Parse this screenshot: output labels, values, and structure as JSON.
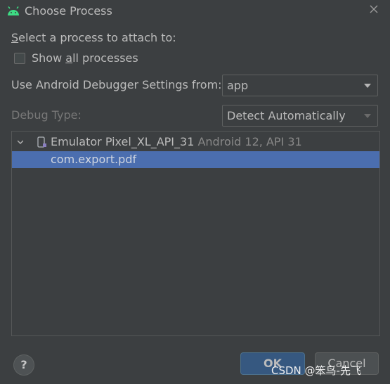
{
  "window": {
    "title": "Choose Process",
    "close_icon": "close-icon"
  },
  "prompt": {
    "label_first_letter": "S",
    "label_rest": "elect a process to attach to:"
  },
  "show_all": {
    "label_pre": "Show ",
    "label_mnemonic": "a",
    "label_post": "ll processes",
    "checked": false
  },
  "debugger_settings": {
    "label": "Use Android Debugger Settings from:",
    "value": "app"
  },
  "debug_type": {
    "label": "Debug Type:",
    "value": "Detect Automatically"
  },
  "tree": {
    "device": {
      "name": "Emulator Pixel_XL_API_31",
      "detail": "Android 12, API 31",
      "expanded": true
    },
    "process": "com.export.pdf"
  },
  "buttons": {
    "help": "?",
    "ok": "OK",
    "cancel": "Cancel"
  },
  "watermark": "CSDN @笨鸟-先飞",
  "colors": {
    "accent_selection": "#4b6eaf",
    "android_green": "#3ddc84",
    "background": "#3c3f41"
  }
}
